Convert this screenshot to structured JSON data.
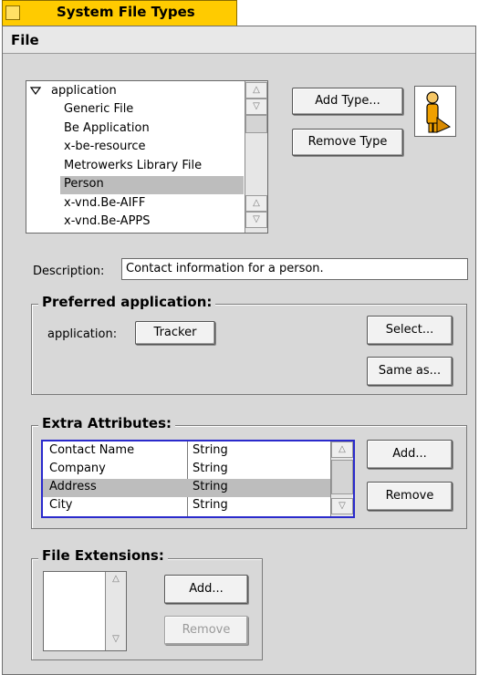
{
  "window": {
    "title": "System File Types"
  },
  "menubar": {
    "file": "File"
  },
  "types_list": {
    "header": "application",
    "items": [
      {
        "label": "Generic File",
        "selected": false
      },
      {
        "label": "Be Application",
        "selected": false
      },
      {
        "label": "x-be-resource",
        "selected": false
      },
      {
        "label": "Metrowerks Library File",
        "selected": false
      },
      {
        "label": "Person",
        "selected": true
      },
      {
        "label": "x-vnd.Be-AIFF",
        "selected": false
      },
      {
        "label": "x-vnd.Be-APPS",
        "selected": false
      }
    ]
  },
  "buttons": {
    "add_type": "Add Type...",
    "remove_type": "Remove Type",
    "select": "Select...",
    "same_as": "Same as...",
    "attr_add": "Add...",
    "attr_remove": "Remove",
    "ext_add": "Add...",
    "ext_remove": "Remove"
  },
  "description": {
    "label": "Description:",
    "value": "Contact information for a person."
  },
  "preferred": {
    "title": "Preferred application:",
    "label": "application:",
    "app": "Tracker"
  },
  "extra_attributes": {
    "title": "Extra Attributes:",
    "rows": [
      {
        "name": "Contact Name",
        "type": "String",
        "selected": false
      },
      {
        "name": "Company",
        "type": "String",
        "selected": false
      },
      {
        "name": "Address",
        "type": "String",
        "selected": true
      },
      {
        "name": "City",
        "type": "String",
        "selected": false
      }
    ]
  },
  "file_extensions": {
    "title": "File Extensions:"
  },
  "icons": {
    "type_icon": "person-icon",
    "colors": {
      "tab": "#ffcb00",
      "person_body": "#f0a000",
      "selection": "#bdbdbd",
      "focus": "#2a2acc"
    }
  }
}
